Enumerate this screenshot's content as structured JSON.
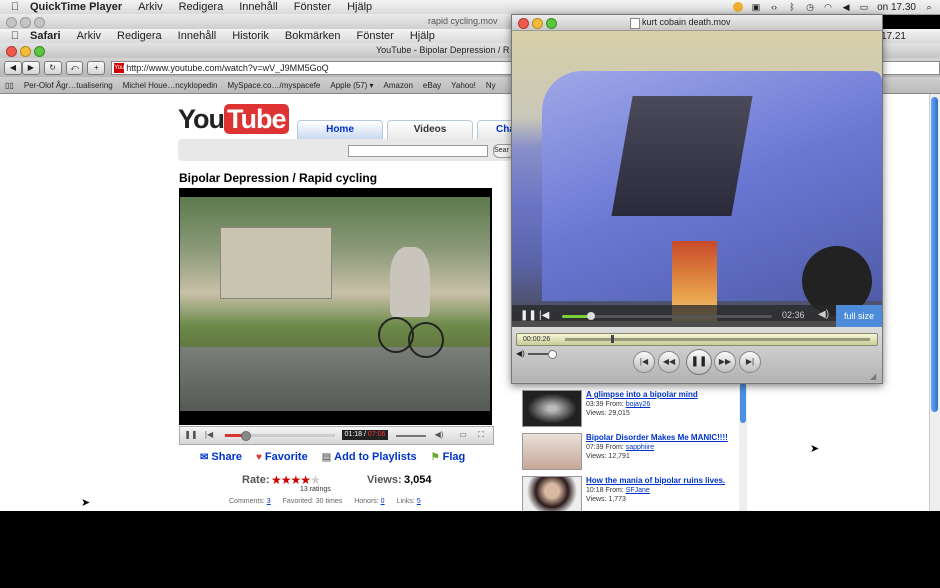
{
  "menubar": {
    "app": "QuickTime Player",
    "items": [
      "Arkiv",
      "Redigera",
      "Innehåll",
      "Fönster",
      "Hjälp"
    ],
    "clock": "on 17.30"
  },
  "qt_back_window": {
    "title": "rapid cycling.mov"
  },
  "safari_menubar": {
    "app": "Safari",
    "items": [
      "Arkiv",
      "Redigera",
      "Innehåll",
      "Historik",
      "Bokmärken",
      "Fönster",
      "Hjälp"
    ],
    "clock": "17.21"
  },
  "safari_window": {
    "title": "YouTube - Bipolar Depression / R"
  },
  "url": "http://www.youtube.com/watch?v=wV_J9MM5GoQ",
  "bookmarks": [
    "Per-Olof Ågr…tualisering",
    "Michel Houe…ncyklopedin",
    "MySpace.co…/myspacefe",
    "Apple (57) ▾",
    "Amazon",
    "eBay",
    "Yahoo!",
    "Ny"
  ],
  "youtube": {
    "logo_you": "You",
    "logo_tube": "Tube",
    "tabs": [
      "Home",
      "Videos",
      "Chann"
    ],
    "search_button": "Sear",
    "video_title": "Bipolar Depression / Rapid cycling",
    "time_current": "01:18",
    "time_total": "07:06",
    "progress": 0.18,
    "actions": {
      "share": "Share",
      "favorite": "Favorite",
      "playlists": "Add to Playlists",
      "flag": "Flag"
    },
    "rate_label": "Rate:",
    "rating": 4,
    "ratings_count": "13 ratings",
    "views_label": "Views:",
    "views": "3,054",
    "stats": {
      "comments_label": "Comments:",
      "comments": "3",
      "favorited_label": "Favorited:",
      "favorited": "30 times",
      "honors_label": "Honors:",
      "honors": "0",
      "links_label": "Links:",
      "links": "5"
    }
  },
  "related": [
    {
      "title": "A glimpse into a bipolar mind",
      "meta": "03:39 From:",
      "user": "bojay26",
      "views": "Views: 29,015"
    },
    {
      "title": "Bipolar Disorder Makes Me MANIC!!!!",
      "meta": "07:39 From:",
      "user": "sapphiire",
      "views": "Views: 12,791"
    },
    {
      "title": "How the mania of bipolar ruins lives.",
      "meta": "10:18 From:",
      "user": "SFJane",
      "views": "Views: 1,773"
    }
  ],
  "quicktime": {
    "title": "kurt cobain death.mov",
    "mini_time": "02:36",
    "mini_progress": 0.14,
    "fullscreen_label": "full size",
    "timeline_time": "00:00:26",
    "timeline_progress": 0.15
  },
  "colors": {
    "yt_red": "#dd3333",
    "link_blue": "#0033cc",
    "qt_green": "#7bd13a",
    "fullsize_blue": "#4d8cd8"
  }
}
